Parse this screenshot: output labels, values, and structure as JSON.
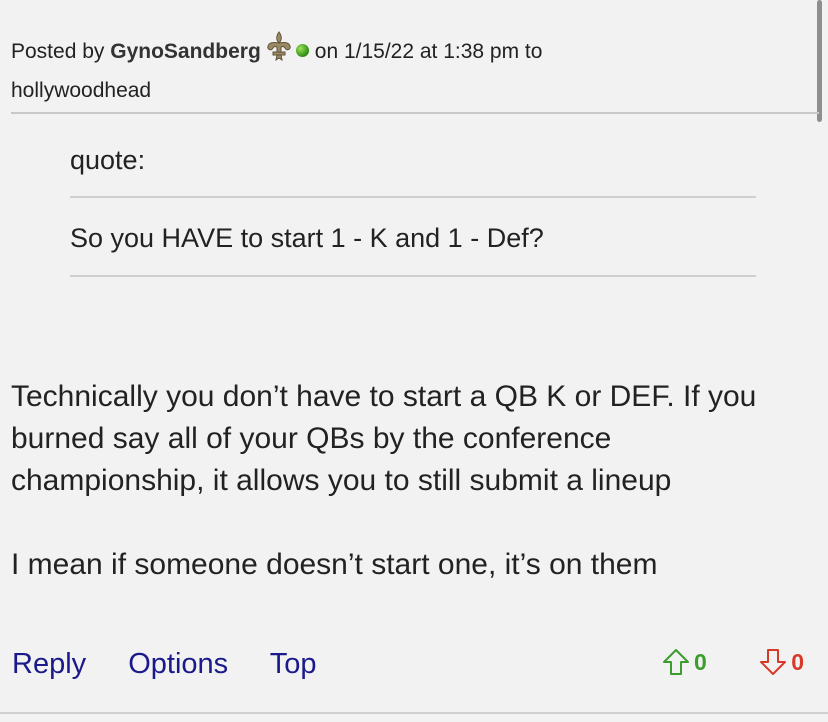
{
  "post": {
    "posted_by_label": "Posted by",
    "username": "GynoSandberg",
    "on_label": "on 1/15/22 at 1:38 pm to",
    "reply_to": "hollywoodhead"
  },
  "quote": {
    "label": "quote:",
    "text": "So you HAVE to start 1 - K and 1 - Def?"
  },
  "body": {
    "paragraphs": [
      "Technically you don’t have to start a QB K or DEF. If you burned say all of your QBs by the conference championship, it allows you to still submit a lineup",
      "I mean if someone doesn’t start one, it’s on them"
    ]
  },
  "actions": {
    "reply": "Reply",
    "options": "Options",
    "top": "Top"
  },
  "votes": {
    "up_count": "0",
    "down_count": "0",
    "up_color": "#3c9c2e",
    "down_color": "#d83a2a"
  },
  "icons": {
    "badge": "fleur-de-lis-icon",
    "online": "online-status-icon",
    "upvote": "arrow-up-icon",
    "downvote": "arrow-down-icon"
  }
}
